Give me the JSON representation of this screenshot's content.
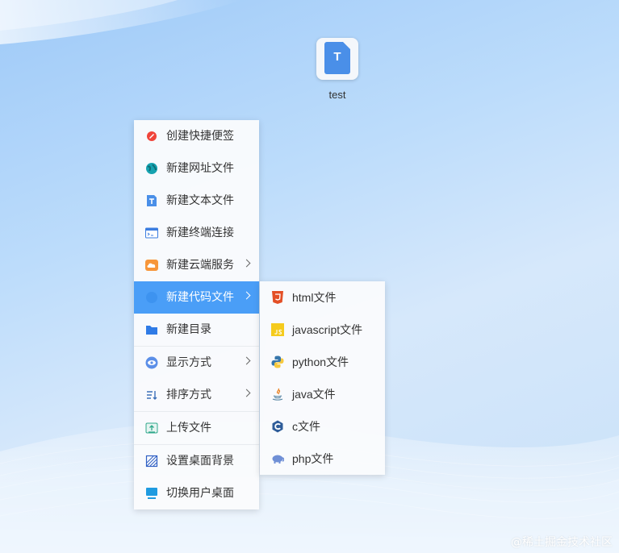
{
  "desktop": {
    "icon_letter": "T",
    "icon_label": "test"
  },
  "context_menu": {
    "items": [
      {
        "label": "创建快捷便签",
        "icon": "note-icon"
      },
      {
        "label": "新建网址文件",
        "icon": "globe-icon"
      },
      {
        "label": "新建文本文件",
        "icon": "text-file-icon"
      },
      {
        "label": "新建终端连接",
        "icon": "terminal-icon"
      },
      {
        "label": "新建云端服务",
        "icon": "cloud-icon",
        "submenu": true
      },
      {
        "label": "新建代码文件",
        "icon": "code-icon",
        "submenu": true,
        "active": true
      },
      {
        "label": "新建目录",
        "icon": "folder-icon"
      },
      {
        "label": "显示方式",
        "icon": "eye-icon",
        "submenu": true
      },
      {
        "label": "排序方式",
        "icon": "sort-icon",
        "submenu": true
      },
      {
        "label": "上传文件",
        "icon": "upload-icon"
      },
      {
        "label": "设置桌面背景",
        "icon": "background-icon"
      },
      {
        "label": "切换用户桌面",
        "icon": "monitor-icon"
      }
    ]
  },
  "code_submenu": {
    "items": [
      {
        "label": "html文件",
        "icon": "html5-icon"
      },
      {
        "label": "javascript文件",
        "icon": "js-icon"
      },
      {
        "label": "python文件",
        "icon": "python-icon"
      },
      {
        "label": "java文件",
        "icon": "java-icon"
      },
      {
        "label": "c文件",
        "icon": "c-icon"
      },
      {
        "label": "php文件",
        "icon": "php-icon"
      }
    ]
  },
  "colors": {
    "accent": "#4a9ef7",
    "file_icon": "#4a8fe8"
  },
  "watermark": "@稀土掘金技术社区"
}
